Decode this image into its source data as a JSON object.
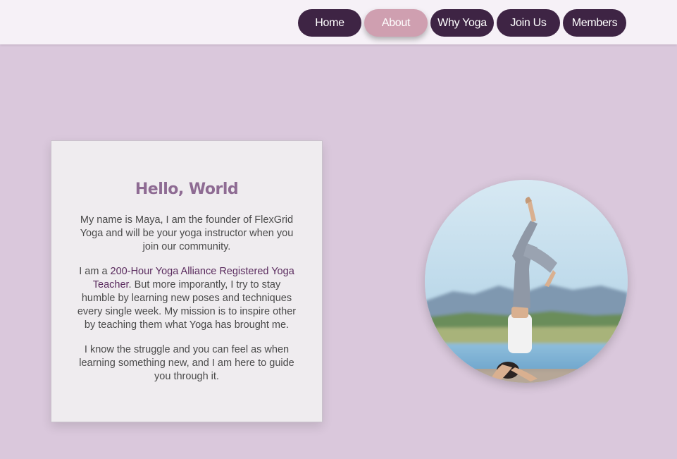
{
  "nav": {
    "items": [
      {
        "label": "Home",
        "active": false
      },
      {
        "label": "About",
        "active": true
      },
      {
        "label": "Why Yoga",
        "active": false
      },
      {
        "label": "Join Us",
        "active": false
      },
      {
        "label": "Members",
        "active": false
      }
    ]
  },
  "about": {
    "title": "Hello, World",
    "paragraph1": "My name is Maya, I am the founder of FlexGrid Yoga and will be your yoga instructor when you join our community.",
    "paragraph2_prefix": "I am a ",
    "paragraph2_highlight": "200-Hour Yoga Alliance Registered Yoga Teacher",
    "paragraph2_suffix": ". But more imporantly, I try to stay humble by learning new poses and techniques every single week. My mission is to inspire other by teaching them what Yoga has brought me.",
    "paragraph3": "I know the struggle and you can feel as when learning something new, and I am here to guide you through it."
  },
  "photo": {
    "subject": "woman-headstand-yoga-photo"
  },
  "colors": {
    "background": "#dac8dc",
    "nav_bar": "#f6f1f7",
    "nav_button": "#3e2444",
    "nav_active": "#cf9fb0",
    "title": "#8e6b93",
    "highlight": "#5a2b5e"
  }
}
